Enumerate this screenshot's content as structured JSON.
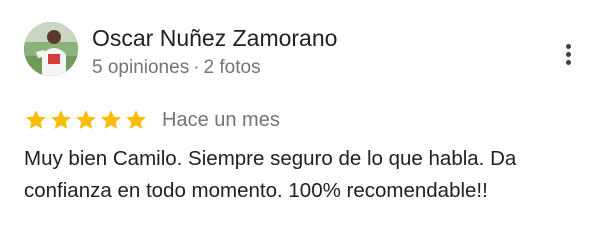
{
  "reviewer": {
    "name": "Oscar Nuñez Zamorano",
    "reviews_count": "5 opiniones",
    "separator": "·",
    "photos_count": "2 fotos"
  },
  "rating": {
    "stars": 5,
    "max_stars": 5,
    "star_color": "#fbbc04",
    "date": "Hace un mes"
  },
  "review": {
    "text": "Muy bien Camilo. Siempre seguro de lo que habla. Da confianza en todo momento. 100% recomendable!!"
  },
  "icons": {
    "more": "more-vert-icon",
    "star": "star-icon"
  }
}
